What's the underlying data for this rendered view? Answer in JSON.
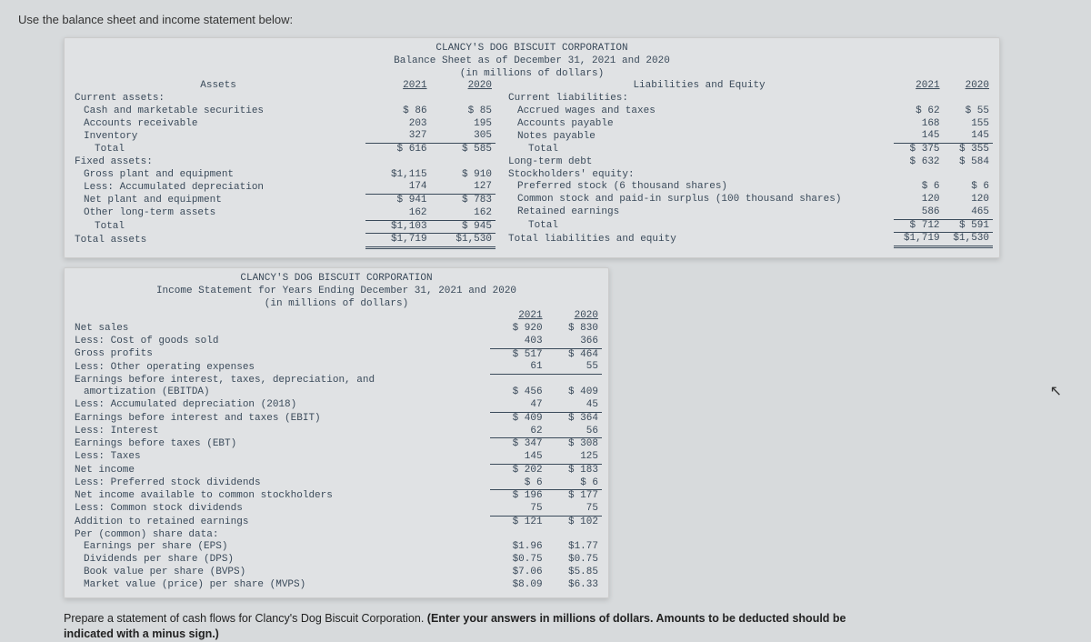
{
  "prompt_top": "Use the balance sheet and income statement below:",
  "bs": {
    "corp": "CLANCY'S DOG BISCUIT CORPORATION",
    "title": "Balance Sheet as of December 31, 2021 and 2020",
    "units": "(in millions of dollars)",
    "assets_h": "Assets",
    "liab_h": "Liabilities and Equity",
    "y21": "2021",
    "y20": "2020",
    "ca": "Current assets:",
    "cash": "Cash and marketable securities",
    "cash21": "$   86",
    "cash20": "$   85",
    "ar": "Accounts receivable",
    "ar21": "203",
    "ar20": "195",
    "inv": "Inventory",
    "inv21": "327",
    "inv20": "305",
    "tca": "Total",
    "tca21": "$  616",
    "tca20": "$  585",
    "fa": "Fixed assets:",
    "gpe": "Gross plant and equipment",
    "gpe21": "$1,115",
    "gpe20": "$  910",
    "ladep": "Less: Accumulated depreciation",
    "ladep21": "174",
    "ladep20": "127",
    "npe": "Net plant and equipment",
    "npe21": "$  941",
    "npe20": "$  783",
    "olt": "Other long-term assets",
    "olt21": "162",
    "olt20": "162",
    "tfa": "Total",
    "tfa21": "$1,103",
    "tfa20": "$  945",
    "ta": "Total assets",
    "ta21": "$1,719",
    "ta20": "$1,530",
    "cl": "Current liabilities:",
    "awt": "Accrued wages and taxes",
    "awt21": "$   62",
    "awt20": "$   55",
    "ap": "Accounts payable",
    "ap21": "168",
    "ap20": "155",
    "np": "Notes payable",
    "np21": "145",
    "np20": "145",
    "tcl": "Total",
    "tcl21": "$  375",
    "tcl20": "$  355",
    "ltd": "Long-term debt",
    "ltd21": "$  632",
    "ltd20": "$  584",
    "se": "Stockholders' equity:",
    "ps": "Preferred stock (6 thousand shares)",
    "ps21": "$    6",
    "ps20": "$    6",
    "cs": "Common stock and paid-in surplus (100 thousand shares)",
    "cs21": "120",
    "cs20": "120",
    "re": "Retained earnings",
    "re21": "586",
    "re20": "465",
    "tse": "Total",
    "tse21": "$  712",
    "tse20": "$  591",
    "tle": "Total liabilities and equity",
    "tle21": "$1,719",
    "tle20": "$1,530"
  },
  "is": {
    "corp": "CLANCY'S DOG BISCUIT CORPORATION",
    "title": "Income Statement for Years Ending December 31, 2021 and 2020",
    "units": "(in millions of dollars)",
    "y21": "2021",
    "y20": "2020",
    "ns": "Net sales",
    "ns21": "$ 920",
    "ns20": "$ 830",
    "cogs": "Less: Cost of goods sold",
    "cogs21": "403",
    "cogs20": "366",
    "gp": "Gross profits",
    "gp21": "$ 517",
    "gp20": "$ 464",
    "ooe": "Less: Other operating expenses",
    "ooe21": "61",
    "ooe20": "55",
    "ebitda1": "Earnings before interest, taxes, depreciation, and",
    "ebitda2": "amortization (EBITDA)",
    "ebitda21": "$ 456",
    "ebitda20": "$ 409",
    "dep": "Less: Accumulated depreciation (2018)",
    "dep21": "47",
    "dep20": "45",
    "ebit": "Earnings before interest and taxes (EBIT)",
    "ebit21": "$ 409",
    "ebit20": "$ 364",
    "int": "Less: Interest",
    "int21": "62",
    "int20": "56",
    "ebt": "Earnings before taxes (EBT)",
    "ebt21": "$ 347",
    "ebt20": "$ 308",
    "tax": "Less: Taxes",
    "tax21": "145",
    "tax20": "125",
    "ni": "Net income",
    "ni21": "$ 202",
    "ni20": "$ 183",
    "psd": "Less: Preferred stock dividends",
    "psd21": "$   6",
    "psd20": "$   6",
    "niac": "Net income available to common stockholders",
    "niac21": "$ 196",
    "niac20": "$ 177",
    "csd": "Less: Common stock dividends",
    "csd21": "75",
    "csd20": "75",
    "are": "Addition to retained earnings",
    "are21": "$ 121",
    "are20": "$ 102",
    "psh": "Per (common) share data:",
    "eps": "Earnings per share (EPS)",
    "eps21": "$1.96",
    "eps20": "$1.77",
    "dps": "Dividends per share (DPS)",
    "dps21": "$0.75",
    "dps20": "$0.75",
    "bvps": "Book value per share (BVPS)",
    "bvps21": "$7.06",
    "bvps20": "$5.85",
    "mvps": "Market value (price) per share (MVPS)",
    "mvps21": "$8.09",
    "mvps20": "$6.33"
  },
  "instr1": "Prepare a statement of cash flows for Clancy's Dog Biscuit Corporation. ",
  "instr2": "(Enter your answers in millions of dollars. Amounts to be deducted should be indicated with a minus sign.)"
}
